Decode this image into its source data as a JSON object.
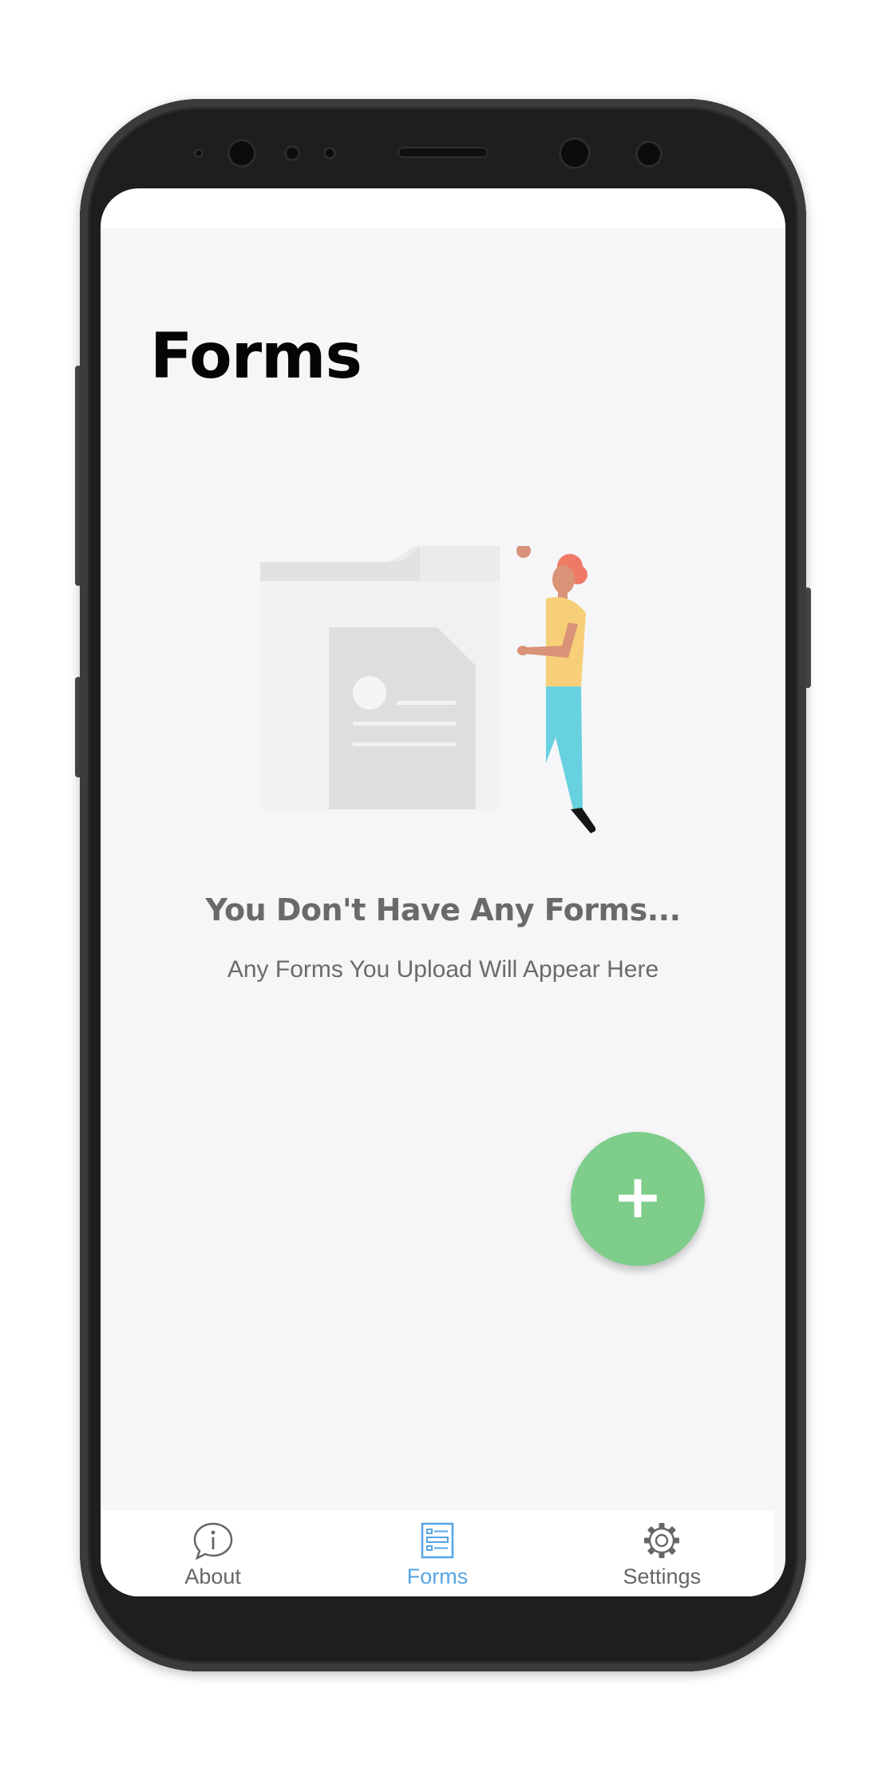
{
  "colors": {
    "background": "#f6f6f8",
    "accent": "#56a5e4",
    "fab": "#7ecd8a",
    "title": "#050505",
    "muted_text": "#6b6b6b"
  },
  "header": {
    "title": "Forms"
  },
  "empty_state": {
    "illustration": "folder-with-person-illustration",
    "title": "You Don't Have Any Forms...",
    "subtitle": "Any Forms You Upload Will Appear Here"
  },
  "fab": {
    "label": "+",
    "icon": "plus-icon"
  },
  "bottom_nav": {
    "active": "Forms",
    "items": [
      {
        "label": "About",
        "icon": "info-icon"
      },
      {
        "label": "Forms",
        "icon": "forms-list-icon"
      },
      {
        "label": "Settings",
        "icon": "gear-icon"
      }
    ]
  }
}
